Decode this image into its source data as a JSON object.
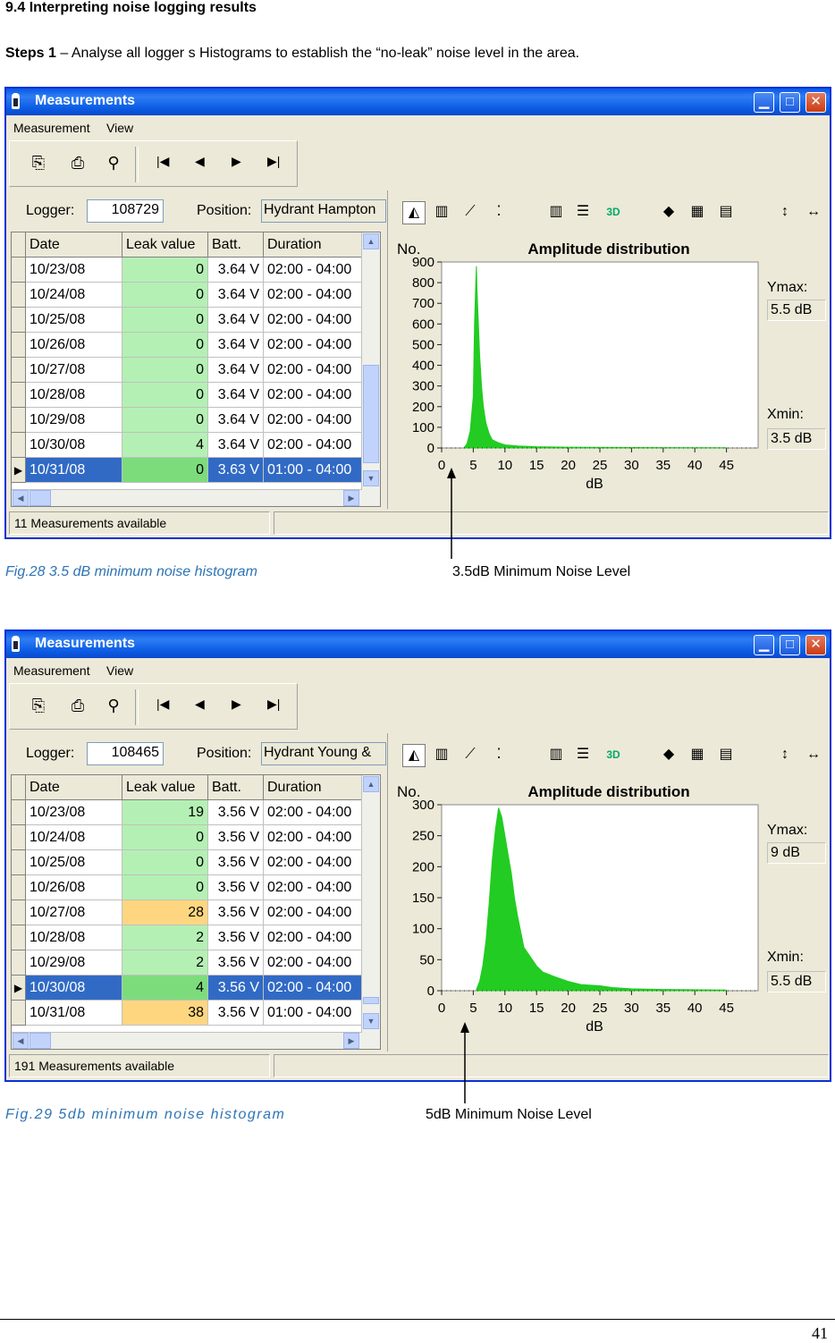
{
  "heading": "9.4 Interpreting noise logging results",
  "steps": {
    "bold": "Steps 1",
    "text": " – Analyse all logger s Histograms to establish the “no-leak” noise level in the area."
  },
  "page_number": "41",
  "figures": [
    {
      "window": {
        "title": "Measurements",
        "menu": [
          "Measurement",
          "View"
        ],
        "logger_label": "Logger:",
        "logger_value": "108729",
        "position_label": "Position:",
        "position_value": "Hydrant Hampton",
        "columns": [
          "Date",
          "Leak value",
          "Batt.",
          "Duration"
        ],
        "rows": [
          {
            "date": "10/23/08",
            "leak": "0",
            "batt": "3.64 V",
            "duration": "02:00 - 04:00",
            "color": "green",
            "selected": false
          },
          {
            "date": "10/24/08",
            "leak": "0",
            "batt": "3.64 V",
            "duration": "02:00 - 04:00",
            "color": "green",
            "selected": false
          },
          {
            "date": "10/25/08",
            "leak": "0",
            "batt": "3.64 V",
            "duration": "02:00 - 04:00",
            "color": "green",
            "selected": false
          },
          {
            "date": "10/26/08",
            "leak": "0",
            "batt": "3.64 V",
            "duration": "02:00 - 04:00",
            "color": "green",
            "selected": false
          },
          {
            "date": "10/27/08",
            "leak": "0",
            "batt": "3.64 V",
            "duration": "02:00 - 04:00",
            "color": "green",
            "selected": false
          },
          {
            "date": "10/28/08",
            "leak": "0",
            "batt": "3.64 V",
            "duration": "02:00 - 04:00",
            "color": "green",
            "selected": false
          },
          {
            "date": "10/29/08",
            "leak": "0",
            "batt": "3.64 V",
            "duration": "02:00 - 04:00",
            "color": "green",
            "selected": false
          },
          {
            "date": "10/30/08",
            "leak": "4",
            "batt": "3.64 V",
            "duration": "02:00 - 04:00",
            "color": "green",
            "selected": false
          },
          {
            "date": "10/31/08",
            "leak": "0",
            "batt": "3.63 V",
            "duration": "01:00 - 04:00",
            "color": "green",
            "selected": true
          }
        ],
        "status": "11 Measurements available",
        "chart_title": "Amplitude distribution",
        "y_label": "No.",
        "ymax_label": "Ymax:",
        "ymax_value": "5.5 dB",
        "xmin_label": "Xmin:",
        "xmin_value": "3.5 dB"
      },
      "caption": "Fig.28  3.5 dB minimum noise histogram",
      "annotation": "3.5dB Minimum Noise Level"
    },
    {
      "window": {
        "title": "Measurements",
        "menu": [
          "Measurement",
          "View"
        ],
        "logger_label": "Logger:",
        "logger_value": "108465",
        "position_label": "Position:",
        "position_value": "Hydrant Young &",
        "columns": [
          "Date",
          "Leak value",
          "Batt.",
          "Duration"
        ],
        "rows": [
          {
            "date": "10/23/08",
            "leak": "19",
            "batt": "3.56 V",
            "duration": "02:00 - 04:00",
            "color": "green",
            "selected": false
          },
          {
            "date": "10/24/08",
            "leak": "0",
            "batt": "3.56 V",
            "duration": "02:00 - 04:00",
            "color": "green",
            "selected": false
          },
          {
            "date": "10/25/08",
            "leak": "0",
            "batt": "3.56 V",
            "duration": "02:00 - 04:00",
            "color": "green",
            "selected": false
          },
          {
            "date": "10/26/08",
            "leak": "0",
            "batt": "3.56 V",
            "duration": "02:00 - 04:00",
            "color": "green",
            "selected": false
          },
          {
            "date": "10/27/08",
            "leak": "28",
            "batt": "3.56 V",
            "duration": "02:00 - 04:00",
            "color": "orange",
            "selected": false
          },
          {
            "date": "10/28/08",
            "leak": "2",
            "batt": "3.56 V",
            "duration": "02:00 - 04:00",
            "color": "green",
            "selected": false
          },
          {
            "date": "10/29/08",
            "leak": "2",
            "batt": "3.56 V",
            "duration": "02:00 - 04:00",
            "color": "green",
            "selected": false
          },
          {
            "date": "10/30/08",
            "leak": "4",
            "batt": "3.56 V",
            "duration": "02:00 - 04:00",
            "color": "green",
            "selected": true
          },
          {
            "date": "10/31/08",
            "leak": "38",
            "batt": "3.56 V",
            "duration": "01:00 - 04:00",
            "color": "orange",
            "selected": false
          }
        ],
        "status": "191 Measurements available",
        "chart_title": "Amplitude distribution",
        "y_label": "No.",
        "ymax_label": "Ymax:",
        "ymax_value": "9 dB",
        "xmin_label": "Xmin:",
        "xmin_value": "5.5 dB"
      },
      "caption": "Fig.29  5db minimum noise histogram",
      "annotation": "5dB Minimum Noise Level"
    }
  ],
  "chart_data": [
    {
      "type": "area",
      "title": "Amplitude distribution",
      "ylabel": "No.",
      "xlabel": "dB",
      "xlim": [
        0,
        50
      ],
      "ylim": [
        0,
        900
      ],
      "xticks": [
        0,
        5,
        10,
        15,
        20,
        25,
        30,
        35,
        40,
        45
      ],
      "yticks": [
        0,
        100,
        200,
        300,
        400,
        500,
        600,
        700,
        800,
        900
      ],
      "x": [
        3.5,
        4.0,
        4.5,
        5.0,
        5.2,
        5.4,
        5.5,
        5.6,
        5.8,
        6.0,
        6.3,
        6.6,
        7.0,
        7.5,
        8.0,
        9.0,
        10.0,
        12.0,
        15.0,
        20.0,
        30.0,
        45.0
      ],
      "values": [
        0,
        20,
        80,
        250,
        600,
        800,
        880,
        760,
        600,
        450,
        300,
        200,
        120,
        70,
        40,
        25,
        15,
        10,
        6,
        4,
        2,
        1
      ],
      "color": "#22cc22",
      "grid": false
    },
    {
      "type": "area",
      "title": "Amplitude distribution",
      "ylabel": "No.",
      "xlabel": "dB",
      "xlim": [
        0,
        50
      ],
      "ylim": [
        0,
        300
      ],
      "xticks": [
        0,
        5,
        10,
        15,
        20,
        25,
        30,
        35,
        40,
        45
      ],
      "yticks": [
        0,
        50,
        100,
        150,
        200,
        250,
        300
      ],
      "x": [
        5.5,
        6.0,
        6.5,
        7.0,
        7.5,
        8.0,
        8.5,
        9.0,
        9.5,
        10.0,
        10.5,
        11.0,
        11.5,
        12.0,
        12.5,
        13.0,
        14.0,
        15.0,
        16.0,
        18.0,
        20.0,
        22.0,
        25.0,
        27.0,
        30.0,
        35.0,
        45.0
      ],
      "values": [
        2,
        15,
        40,
        80,
        140,
        210,
        260,
        295,
        280,
        250,
        220,
        190,
        150,
        120,
        95,
        70,
        55,
        40,
        30,
        22,
        15,
        10,
        8,
        5,
        3,
        2,
        1
      ],
      "color": "#22cc22",
      "grid": false
    }
  ]
}
